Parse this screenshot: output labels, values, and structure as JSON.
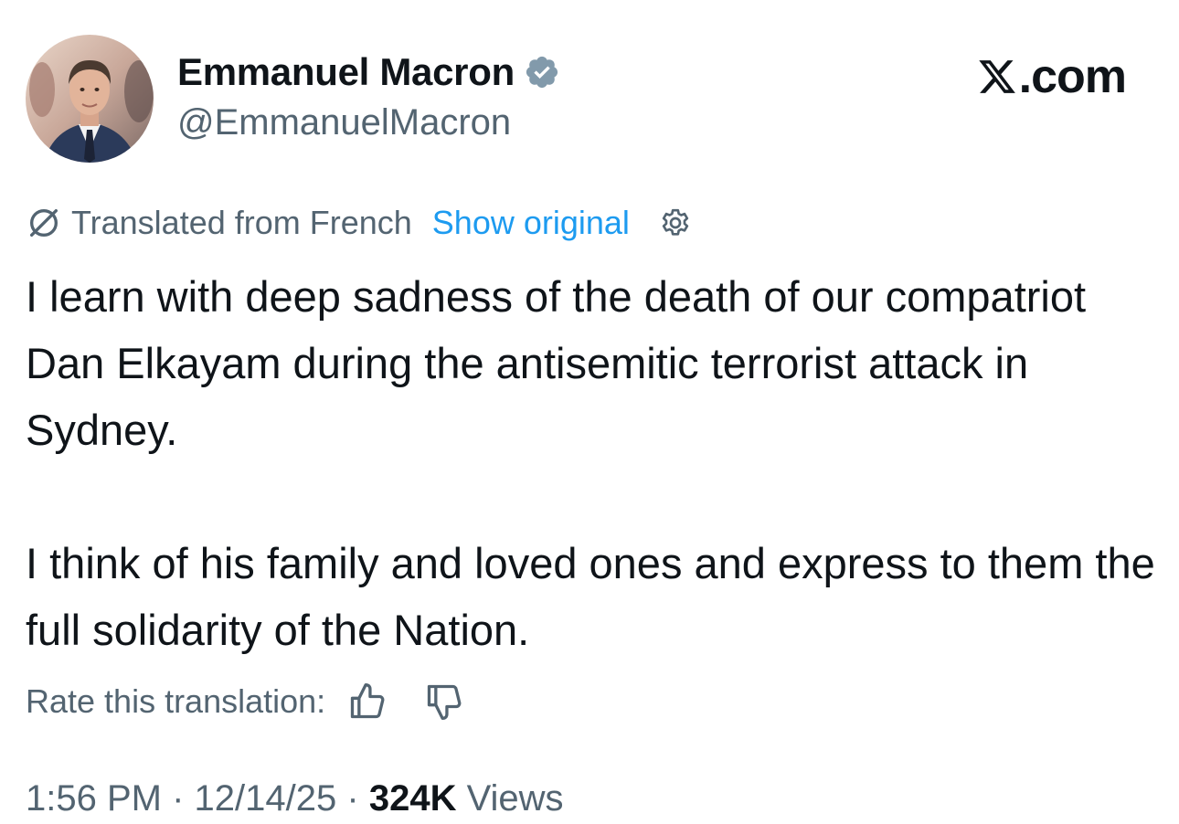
{
  "author": {
    "display_name": "Emmanuel Macron",
    "handle": "@EmmanuelMacron",
    "avatar_icon": "avatar-photo",
    "verified_icon": "verified-badge-icon",
    "verified_color": "#829aab"
  },
  "site": {
    "label": ".com",
    "logo_icon": "x-logo-icon"
  },
  "translation": {
    "label": "Translated from French",
    "show_original": "Show original",
    "link_color": "#1d9bf0"
  },
  "tweet": {
    "paragraphs": [
      "I learn with deep sadness of the death of our compatriot Dan Elkayam during the antisemitic terrorist attack in Sydney.",
      "I think of his family and loved ones and express to them the full solidarity of the Nation."
    ]
  },
  "rating": {
    "label": "Rate this translation:"
  },
  "meta": {
    "time": "1:56 PM",
    "separator": "·",
    "date": "12/14/25",
    "views_count": "324K",
    "views_label": "Views"
  }
}
